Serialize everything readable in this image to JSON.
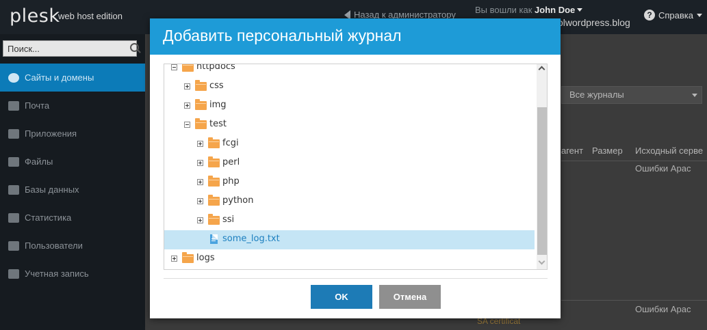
{
  "topbar": {
    "logo": "plesk",
    "edition": "web host edition",
    "back_link": "Назад к администратору",
    "logged_in_as_label": "Вы вошли как",
    "user_name": "John Doe",
    "domain": "olwordpress.blog",
    "help_label": "Справка"
  },
  "sidebar": {
    "search_placeholder": "Поиск...",
    "items": [
      {
        "label": "Сайты и домены",
        "icon": "globe-icon",
        "active": true
      },
      {
        "label": "Почта",
        "icon": "mail-icon"
      },
      {
        "label": "Приложения",
        "icon": "gear-icon"
      },
      {
        "label": "Файлы",
        "icon": "folder-icon"
      },
      {
        "label": "Базы данных",
        "icon": "database-icon"
      },
      {
        "label": "Статистика",
        "icon": "bar-chart-icon"
      },
      {
        "label": "Пользователи",
        "icon": "user-icon"
      },
      {
        "label": "Учетная запись",
        "icon": "briefcase-icon"
      }
    ]
  },
  "background": {
    "select_value": "Все журналы",
    "col_agent": "агент",
    "col_size": "Размер",
    "col_source": "Исходный серве",
    "cell_source_1": "Ошибки Apac",
    "cell_source_2": "Ошибки Apac",
    "cert_text": "SA certificat"
  },
  "modal": {
    "title": "Добавить персональный журнал",
    "tree": [
      {
        "label": "httpdocs",
        "type": "folder",
        "expander": "minus"
      },
      {
        "label": "css",
        "type": "folder",
        "expander": "plus"
      },
      {
        "label": "img",
        "type": "folder",
        "expander": "plus"
      },
      {
        "label": "test",
        "type": "folder",
        "expander": "minus"
      },
      {
        "label": "fcgi",
        "type": "folder",
        "expander": "plus"
      },
      {
        "label": "perl",
        "type": "folder",
        "expander": "plus"
      },
      {
        "label": "php",
        "type": "folder",
        "expander": "plus"
      },
      {
        "label": "python",
        "type": "folder",
        "expander": "plus"
      },
      {
        "label": "ssi",
        "type": "folder",
        "expander": "plus"
      },
      {
        "label": "some_log.txt",
        "type": "file",
        "selected": true
      },
      {
        "label": "logs",
        "type": "folder",
        "expander": "plus"
      }
    ],
    "ok_label": "OK",
    "cancel_label": "Отмена"
  },
  "colors": {
    "header_blue": "#1e9bd7",
    "ok_blue": "#1d7bb6",
    "cancel_gray": "#8f8f8f",
    "selected_row": "#c5e5f5",
    "folder_orange": "#f5a54b",
    "sidebar_active": "#0c7bb8"
  }
}
